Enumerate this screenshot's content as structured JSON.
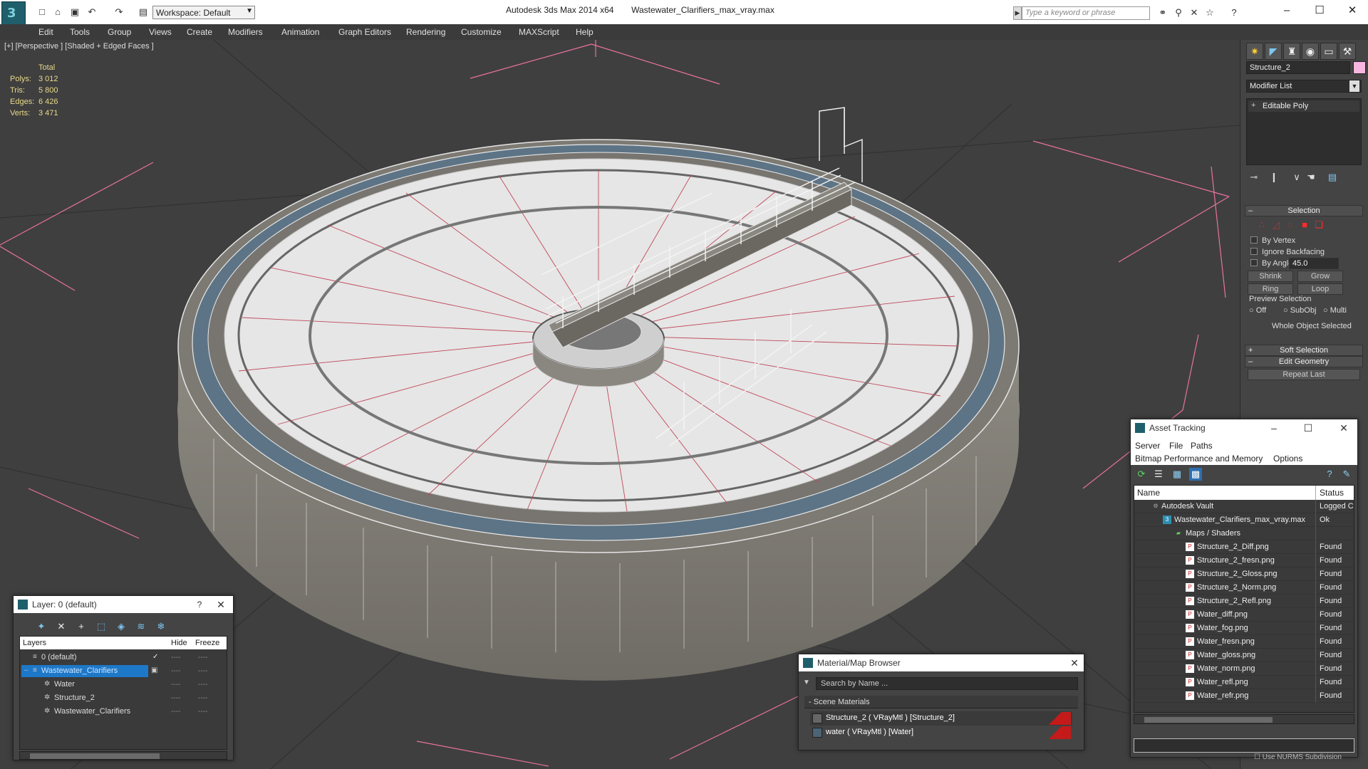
{
  "title_bar": {
    "workspace": "Workspace: Default",
    "app_title": "Autodesk 3ds Max  2014 x64",
    "file_title": "Wastewater_Clarifiers_max_vray.max",
    "search_placeholder": "Type a keyword or phrase"
  },
  "menu": [
    "Edit",
    "Tools",
    "Group",
    "Views",
    "Create",
    "Modifiers",
    "Animation",
    "Graph Editors",
    "Rendering",
    "Customize",
    "MAXScript",
    "Help"
  ],
  "viewport": {
    "label": "[+] [Perspective ] [Shaded + Edged Faces ]",
    "stats": {
      "header": "Total",
      "rows": [
        {
          "label": "Polys:",
          "value": "3 012"
        },
        {
          "label": "Tris:",
          "value": "5 800"
        },
        {
          "label": "Edges:",
          "value": "6 426"
        },
        {
          "label": "Verts:",
          "value": "3 471"
        }
      ]
    }
  },
  "command_panel": {
    "object_name": "Structure_2",
    "object_color": "#f7b6e0",
    "modifier_list": "Modifier List",
    "modifier_stack": [
      "Editable Poly"
    ],
    "selection": {
      "title": "Selection",
      "by_vertex": "By Vertex",
      "ignore_backfacing": "Ignore Backfacing",
      "by_angle": "By Angle:",
      "angle_value": "45.0",
      "shrink": "Shrink",
      "grow": "Grow",
      "ring": "Ring",
      "loop": "Loop",
      "preview_title": "Preview Selection",
      "preview_off": "Off",
      "preview_subobj": "SubObj",
      "preview_multi": "Multi",
      "status": "Whole Object Selected"
    },
    "soft_selection": "Soft Selection",
    "edit_geometry": "Edit Geometry",
    "repeat_last": "Repeat Last"
  },
  "layer_dialog": {
    "title": "Layer: 0 (default)",
    "help": "?",
    "columns": {
      "layers": "Layers",
      "hide": "Hide",
      "freeze": "Freeze"
    },
    "rows": [
      {
        "name": "0 (default)",
        "selected": false
      },
      {
        "name": "Wastewater_Clarifiers",
        "selected": true
      },
      {
        "name": "Water",
        "selected": false
      },
      {
        "name": "Structure_2",
        "selected": false
      },
      {
        "name": "Wastewater_Clarifiers",
        "selected": false
      }
    ]
  },
  "material_browser": {
    "title": "Material/Map Browser",
    "search_placeholder": "Search by Name ...",
    "group": "Scene Materials",
    "items": [
      "Structure_2  ( VRayMtl )  [Structure_2]",
      "water  ( VRayMtl )  [Water]"
    ]
  },
  "asset_tracking": {
    "title": "Asset Tracking",
    "menu_row1": [
      "Server",
      "File",
      "Paths"
    ],
    "menu_row2": [
      "Bitmap Performance and Memory",
      "Options"
    ],
    "columns": {
      "name": "Name",
      "status": "Status"
    },
    "rows": [
      {
        "name": "Autodesk Vault",
        "status": "Logged C"
      },
      {
        "name": "Wastewater_Clarifiers_max_vray.max",
        "status": "Ok"
      },
      {
        "name": "Maps / Shaders",
        "status": ""
      },
      {
        "name": "Structure_2_Diff.png",
        "status": "Found"
      },
      {
        "name": "Structure_2_fresn.png",
        "status": "Found"
      },
      {
        "name": "Structure_2_Gloss.png",
        "status": "Found"
      },
      {
        "name": "Structure_2_Norm.png",
        "status": "Found"
      },
      {
        "name": "Structure_2_Refl.png",
        "status": "Found"
      },
      {
        "name": "Water_diff.png",
        "status": "Found"
      },
      {
        "name": "Water_fog.png",
        "status": "Found"
      },
      {
        "name": "Water_fresn.png",
        "status": "Found"
      },
      {
        "name": "Water_gloss.png",
        "status": "Found"
      },
      {
        "name": "Water_norm.png",
        "status": "Found"
      },
      {
        "name": "Water_refl.png",
        "status": "Found"
      },
      {
        "name": "Water_refr.png",
        "status": "Found"
      }
    ]
  },
  "bottom_note": "Use NURMS Subdivision"
}
